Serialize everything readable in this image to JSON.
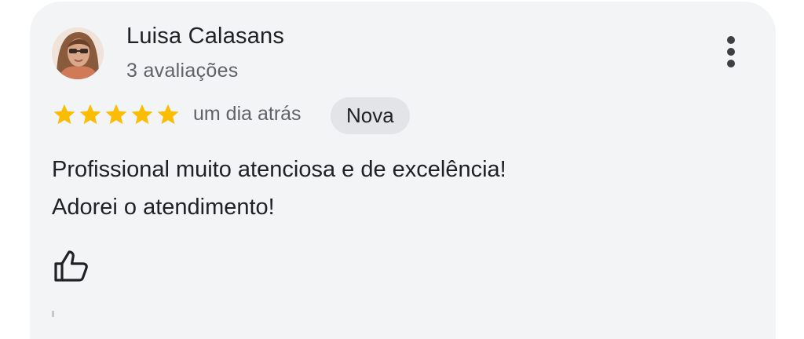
{
  "review": {
    "author": {
      "name": "Luisa Calasans",
      "review_count": "3 avaliações",
      "avatar_icon": "profile-photo"
    },
    "rating": 5,
    "rating_max": 5,
    "time_ago": "um dia atrás",
    "badge": "Nova",
    "text_lines": [
      "Profissional muito atenciosa e de excelência!",
      "Adorei o atendimento!"
    ],
    "actions": {
      "more_icon": "more-vert-icon",
      "like_icon": "thumb-up-icon"
    }
  },
  "colors": {
    "card_background": "#f3f4f6",
    "star": "#fbbc04",
    "badge_background": "#e3e4e8",
    "primary_text": "#202124",
    "secondary_text": "#5f6368"
  }
}
